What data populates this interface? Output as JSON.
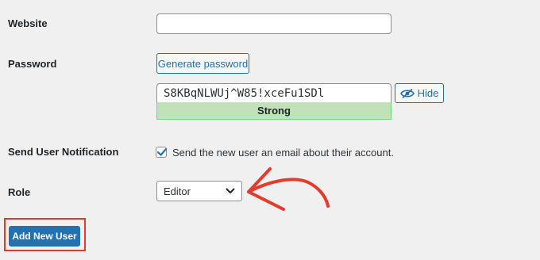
{
  "website": {
    "label": "Website",
    "value": ""
  },
  "password": {
    "label": "Password",
    "generate_label": "Generate password",
    "value": "S8KBqNLWUj^W85!xceFu1SDl",
    "hide_label": "Hide",
    "strength": "Strong"
  },
  "notification": {
    "label": "Send User Notification",
    "checked": true,
    "text": "Send the new user an email about their account."
  },
  "role": {
    "label": "Role",
    "selected": "Editor"
  },
  "submit": {
    "label": "Add New User"
  },
  "colors": {
    "primary": "#2271b1",
    "strength_bg": "#c1e1b9",
    "annotation": "#e53b2c"
  }
}
